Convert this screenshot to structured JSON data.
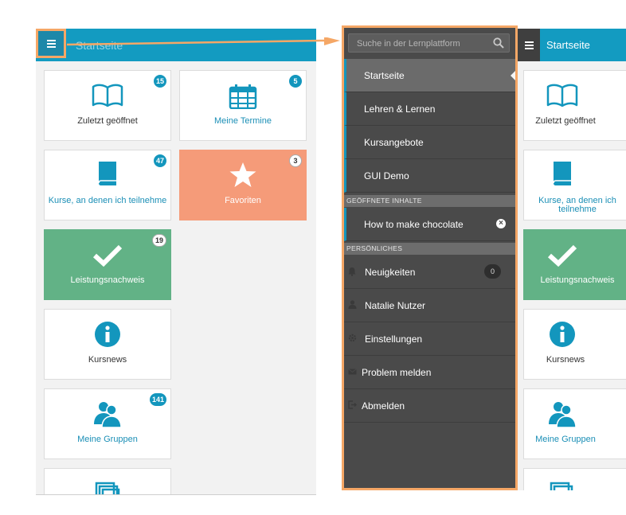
{
  "left_screen": {
    "header_title": "Startseite",
    "tiles": [
      {
        "label": "Zuletzt geöffnet",
        "badge": "15",
        "icon": "book-icon"
      },
      {
        "label": "Meine Termine",
        "badge": "5",
        "icon": "calendar-icon"
      },
      {
        "label": "Kurse, an denen ich teilnehme",
        "badge": "47",
        "icon": "course-book-icon"
      },
      {
        "label": "Favoriten",
        "badge": "3",
        "icon": "star-icon"
      },
      {
        "label": "Leistungsnachweis",
        "badge": "19",
        "icon": "checkmark-icon"
      },
      {
        "label": "Kursnews",
        "badge": "",
        "icon": "info-icon"
      },
      {
        "label": "Meine Gruppen",
        "badge": "141",
        "icon": "group-icon"
      }
    ]
  },
  "menu": {
    "search_placeholder": "Suche in der Lernplattform",
    "nav_items": [
      "Startseite",
      "Lehren & Lernen",
      "Kursangebote",
      "GUI Demo"
    ],
    "section_open": "GEÖFFNETE INHALTE",
    "open_item": "How to make chocolate",
    "section_personal": "PERSÖNLICHES",
    "personal_items": [
      {
        "label": "Neuigkeiten",
        "icon": "bell-icon",
        "count": "0"
      },
      {
        "label": "Natalie Nutzer",
        "icon": "user-icon"
      },
      {
        "label": "Einstellungen",
        "icon": "gear-icon"
      },
      {
        "label": "Problem melden",
        "icon": "envelope-icon"
      },
      {
        "label": "Abmelden",
        "icon": "logout-icon"
      }
    ]
  },
  "right_screen": {
    "header_title": "Startseite",
    "tiles": [
      "Zuletzt geöffnet",
      "Kurse, an denen ich teilnehme",
      "Leistungsnachweis",
      "Kursnews",
      "Meine Gruppen"
    ]
  },
  "colors": {
    "brand_blue": "#139bc1",
    "highlight_orange": "#f5a766",
    "favorites_salmon": "#f59b79",
    "success_green": "#62b286",
    "menu_dark": "#4a4a4a"
  }
}
